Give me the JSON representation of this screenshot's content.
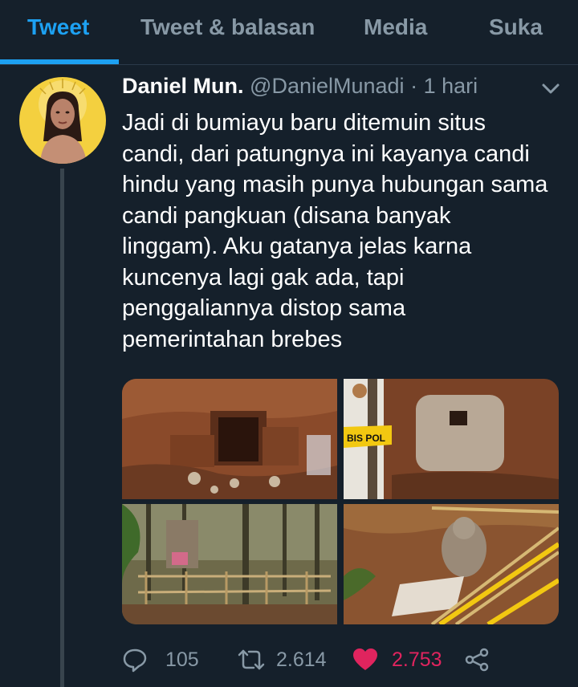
{
  "tabs": [
    {
      "label": "Tweet"
    },
    {
      "label": "Tweet & balasan"
    },
    {
      "label": "Media"
    },
    {
      "label": "Suka"
    }
  ],
  "tweet": {
    "name": "Daniel Mun.",
    "handle": "@DanielMunadi",
    "separator": "·",
    "time": "1 hari",
    "lines": [
      "Jadi di bumiayu baru ditemuin situs",
      "candi, dari patungnya ini kayanya candi",
      "hindu yang masih punya hubungan sama",
      "candi pangkuan (disana banyak",
      "linggam). Aku gatanya jelas karna",
      "kuncenya lagi gak ada, tapi",
      "penggaliannya distop sama",
      "pemerintahan brebes"
    ],
    "police_tape_text": "BIS POL",
    "actions": {
      "reply_count": "105",
      "retweet_count": "2.614",
      "like_count": "2.753"
    }
  },
  "colors": {
    "background": "#15202b",
    "accent": "#1da1f2",
    "muted": "#8899a6",
    "like": "#e0245e"
  },
  "icons": [
    "chevron-down-icon",
    "reply-icon",
    "retweet-icon",
    "heart-icon",
    "share-icon"
  ]
}
